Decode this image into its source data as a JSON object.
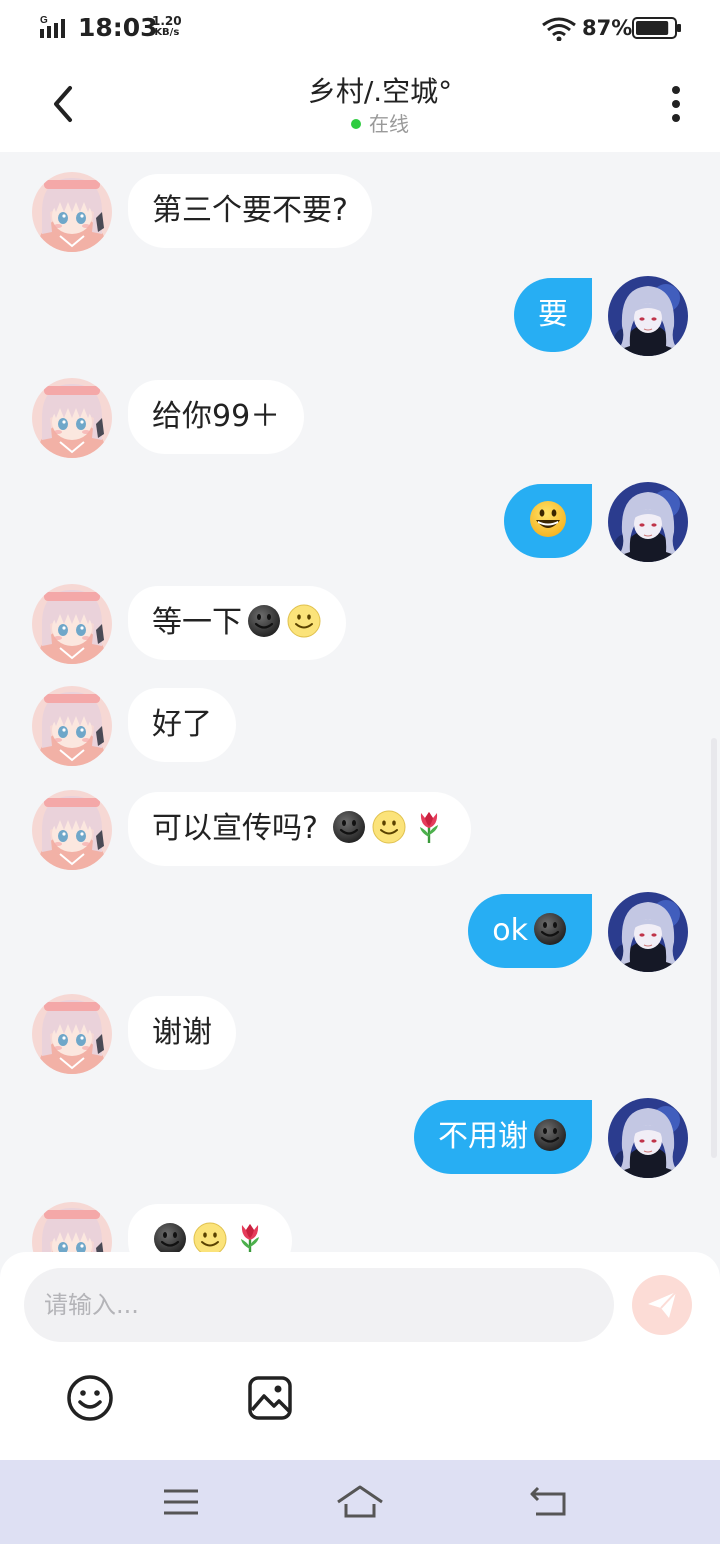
{
  "status_bar": {
    "time": "18:03",
    "network_type": "G",
    "speed_value": "1.20",
    "speed_unit": "KB/s",
    "battery_percent": "87%",
    "battery_level": 0.87
  },
  "header": {
    "title": "乡村/.空城°",
    "status": "在线"
  },
  "messages": [
    {
      "side": "left",
      "text": "第三个要不要?",
      "emojis": []
    },
    {
      "side": "right",
      "text": "要",
      "emojis": []
    },
    {
      "side": "left",
      "text": "给你99＋",
      "emojis": []
    },
    {
      "side": "right",
      "text": "",
      "emojis": [
        "grinning-face"
      ]
    },
    {
      "side": "left",
      "text": "等一下",
      "emojis": [
        "dark-smiley",
        "slightly-smiling-face"
      ]
    },
    {
      "side": "left",
      "text": "好了",
      "emojis": []
    },
    {
      "side": "left",
      "text": "可以宣传吗? ",
      "emojis": [
        "dark-smiley",
        "slightly-smiling-face",
        "tulip"
      ]
    },
    {
      "side": "right",
      "text": "ok",
      "emojis": [
        "dark-smiley"
      ]
    },
    {
      "side": "left",
      "text": "谢谢",
      "emojis": []
    },
    {
      "side": "right",
      "text": "不用谢",
      "emojis": [
        "dark-smiley"
      ]
    },
    {
      "side": "left",
      "text": "",
      "emojis": [
        "dark-smiley",
        "slightly-smiling-face",
        "tulip"
      ]
    }
  ],
  "input": {
    "placeholder": "请输入...",
    "value": ""
  },
  "colors": {
    "accent": "#27aef3",
    "background": "#f4f5f7",
    "online": "#2ecc40",
    "send_button": "#fcdcd6",
    "nav_bar": "#dee0f3"
  },
  "icons": {
    "back": "back-arrow-icon",
    "more": "more-vertical-icon",
    "send": "send-icon",
    "emoji": "emoji-icon",
    "image": "image-icon",
    "nav_menu": "menu-icon",
    "nav_home": "home-icon",
    "nav_back": "return-icon"
  }
}
